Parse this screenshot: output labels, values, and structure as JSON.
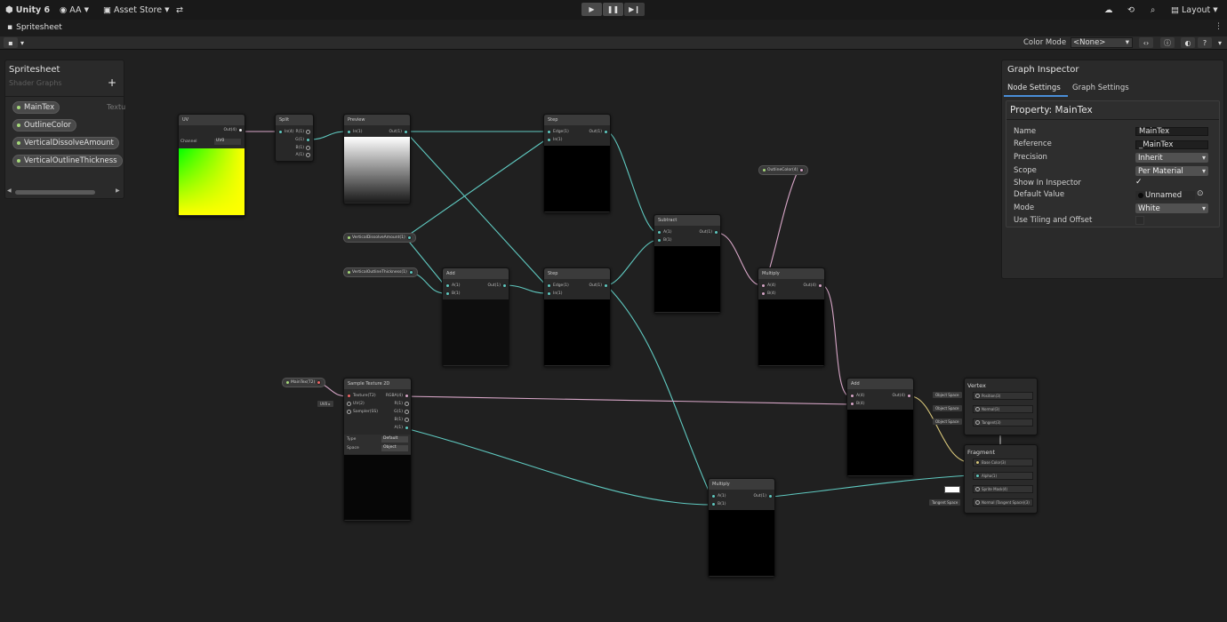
{
  "toolbar": {
    "unity_label": "Unity 6",
    "account_label": "AA",
    "asset_store_label": "Asset Store",
    "layout_label": "Layout"
  },
  "tab": {
    "title": "Spritesheet"
  },
  "graph_toolbar": {
    "color_mode_label": "Color Mode",
    "color_mode_value": "<None>"
  },
  "blackboard": {
    "title": "Spritesheet",
    "subtitle": "Shader Graphs",
    "add_symbol": "+",
    "properties": [
      {
        "label": "MainTex",
        "type": "Textu"
      },
      {
        "label": "OutlineColor"
      },
      {
        "label": "VerticalDissolveAmount"
      },
      {
        "label": "VerticalOutlineThickness"
      }
    ]
  },
  "inspector": {
    "title": "Graph Inspector",
    "tabs": [
      "Node Settings",
      "Graph Settings"
    ],
    "section_title": "Property: MainTex",
    "rows": {
      "name_label": "Name",
      "name_value": "MainTex",
      "reference_label": "Reference",
      "reference_value": "_MainTex",
      "precision_label": "Precision",
      "precision_value": "Inherit",
      "scope_label": "Scope",
      "scope_value": "Per Material",
      "show_inspector_label": "Show In Inspector",
      "default_value_label": "Default Value",
      "default_value_value": "Unnamed",
      "mode_label": "Mode",
      "mode_value": "White",
      "tiling_label": "Use Tiling and Offset"
    }
  },
  "nodes": {
    "uv": {
      "title": "UV",
      "out": "Out(4)",
      "channel_label": "Channel",
      "channel_value": "UV0"
    },
    "split": {
      "title": "Split",
      "in": "In(4)",
      "outs": [
        "R(1)",
        "G(1)",
        "B(1)",
        "A(1)"
      ]
    },
    "preview": {
      "title": "Preview",
      "in": "In(1)",
      "out": "Out(1)"
    },
    "step1": {
      "title": "Step",
      "ins": [
        "Edge(1)",
        "In(1)"
      ],
      "out": "Out(1)"
    },
    "step2": {
      "title": "Step",
      "ins": [
        "Edge(1)",
        "In(1)"
      ],
      "out": "Out(1)"
    },
    "add1": {
      "title": "Add",
      "ins": [
        "A(1)",
        "B(1)"
      ],
      "out": "Out(1)"
    },
    "subtract": {
      "title": "Subtract",
      "ins": [
        "A(1)",
        "B(1)"
      ],
      "out": "Out(1)"
    },
    "multiply1": {
      "title": "Multiply",
      "ins": [
        "A(4)",
        "B(4)"
      ],
      "out": "Out(4)"
    },
    "add2": {
      "title": "Add",
      "ins": [
        "A(4)",
        "B(4)"
      ],
      "out": "Out(4)"
    },
    "multiply2": {
      "title": "Multiply",
      "ins": [
        "A(1)",
        "B(1)"
      ],
      "out": "Out(1)"
    },
    "sample": {
      "title": "Sample Texture 2D",
      "ins": [
        "Texture(T2)",
        "UV(2)",
        "Sampler(SS)"
      ],
      "outs": [
        "RGBA(4)",
        "R(1)",
        "G(1)",
        "B(1)",
        "A(1)"
      ],
      "type_label": "Type",
      "type_value": "Default",
      "space_label": "Space",
      "space_value": "Object"
    },
    "vertex": {
      "title": "Vertex",
      "slots": [
        "Position(3)",
        "Normal(3)",
        "Tangent(3)"
      ],
      "spaces": [
        "Object Space",
        "Object Space",
        "Object Space"
      ]
    },
    "fragment": {
      "title": "Fragment",
      "slots": [
        "Base Color(3)",
        "Alpha(1)",
        "Sprite Mask(4)",
        "Normal (Tangent Space)(3)"
      ],
      "tangent_space": "Tangent Space"
    },
    "prop_dissolve": "VerticalDissolveAmount(1)",
    "prop_thickness": "VerticalOutlineThickness(1)",
    "prop_outline": "OutlineColor(4)",
    "prop_maintex": "MainTex(T2)",
    "uv0_box": "UV0"
  },
  "colors": {
    "accent": "#5fc9c0",
    "pink": "#d7a6c7",
    "preview_white": "#ffffff"
  }
}
